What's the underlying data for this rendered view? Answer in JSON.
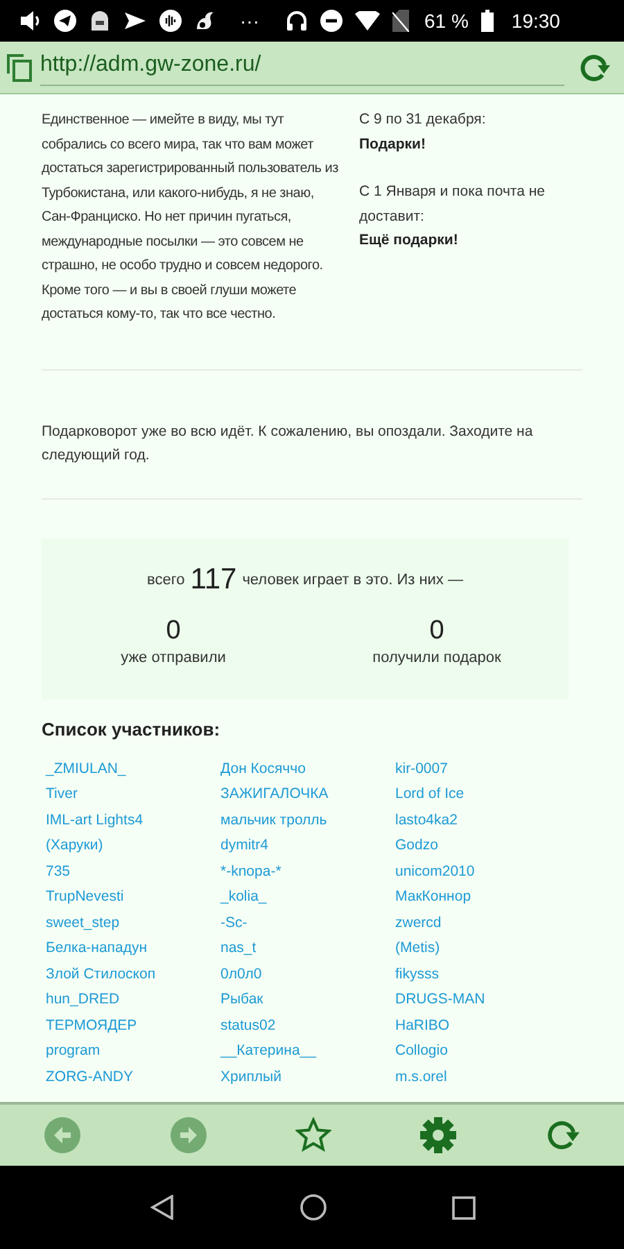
{
  "status_bar": {
    "dots": "···",
    "battery_text": "61 %",
    "time": "19:30"
  },
  "browser": {
    "url": "http://adm.gw-zone.ru/"
  },
  "intro": {
    "text": "Единственное — имейте в виду, мы тут собрались со всего мира, так что вам может достаться зарегистрированный пользователь из Турбокистана, или какого-нибудь, я не знаю, Сан-Франциско. Но нет причин пугаться, международные посылки — это совсем не страшно, не особо трудно и совсем недорого. Кроме того — и вы в своей глуши можете достаться кому-то, так что все честно.",
    "schedule": [
      {
        "dates": "С 9 по 31 декабря:",
        "event": "Подарки!"
      },
      {
        "dates": "С 1 Января и пока почта не доставит:",
        "event": "Ещё подарки!"
      }
    ]
  },
  "notice": "Подарковорот уже во всю идёт. К сожалению, вы опоздали. Заходите на следующий год.",
  "stats": {
    "prefix": "всего",
    "total": "117",
    "suffix": "человек играет в это. Из них —",
    "counters": [
      {
        "value": "0",
        "label": "уже отправили"
      },
      {
        "value": "0",
        "label": "получили подарок"
      }
    ]
  },
  "participants": {
    "title": "Список участников:",
    "names": [
      "_ZMIULAN_",
      "Дон Косяччо",
      "kir-0007",
      "Tiver",
      "ЗАЖИГАЛОЧКА",
      "Lord of Ice",
      "IML-art Lights4",
      "мальчик тролль",
      "lasto4ka2",
      "(Харуки)",
      "dymitr4",
      "Godzo",
      "735",
      "*-knopa-*",
      "unicom2010",
      "TrupNevesti",
      "_kolia_",
      "МакКоннор",
      "sweet_step",
      "-Sc-",
      "zwercd",
      "Белка-нападун",
      "nas_t",
      "(Metis)",
      "Злой Стилоскоп",
      "0л0л0",
      "fikysss",
      "hun_DRED",
      "Рыбак",
      "DRUGS-MAN",
      "ТЕРМОЯДЕР",
      "status02",
      "HaRIBO",
      "program",
      "__Катерина__",
      "Collogio",
      "ZORG-ANDY",
      "Хриплый",
      "m.s.orel"
    ]
  },
  "toolbar": [
    {
      "kind": "back",
      "disabled": true
    },
    {
      "kind": "forward",
      "disabled": true
    },
    {
      "kind": "star",
      "disabled": false
    },
    {
      "kind": "settings",
      "disabled": false
    },
    {
      "kind": "reload",
      "disabled": false
    }
  ]
}
